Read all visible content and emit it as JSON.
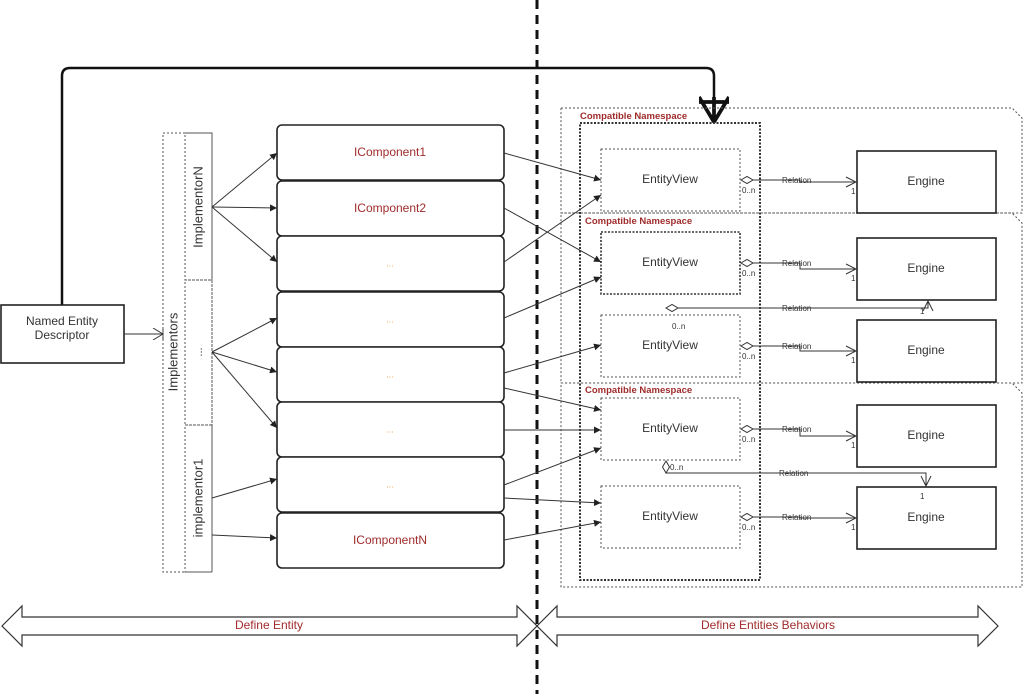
{
  "descriptor": {
    "line1": "Named Entity",
    "line2": "Descriptor"
  },
  "implementors": {
    "title": "Implementors",
    "items": [
      "ImplementorN",
      "...",
      "implementor1"
    ]
  },
  "components": [
    "IComponent1",
    "IComponent2",
    "...",
    "...",
    "...",
    "...",
    "...",
    "IComponentN"
  ],
  "namespaces": [
    "Compatible Namespace",
    "Compatible Namespace",
    "Compatible Namespace"
  ],
  "entity_views": [
    "EntityView",
    "EntityView",
    "EntityView",
    "EntityView",
    "EntityView"
  ],
  "engines": [
    "Engine",
    "Engine",
    "Engine",
    "Engine",
    "Engine"
  ],
  "relation": {
    "label": "Relation",
    "many": "0..n",
    "one": "1"
  },
  "bottom": {
    "left": "Define Entity",
    "right": "Define Entities Behaviors"
  },
  "colors": {
    "component_label": "#a02c2c",
    "placeholder_label": "#f0a050",
    "namespace_label": "#a02c2c"
  }
}
